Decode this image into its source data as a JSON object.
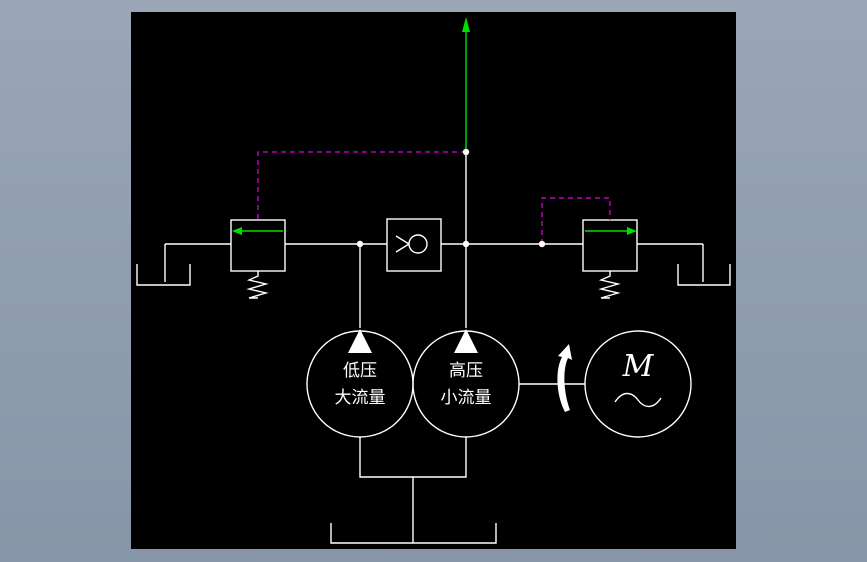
{
  "pump_low": {
    "line1": "低压",
    "line2": "大流量"
  },
  "pump_high": {
    "line1": "高压",
    "line2": "小流量"
  },
  "motor": {
    "letter": "M"
  },
  "colors": {
    "background": "#000000",
    "frame": "#8f9bad",
    "lines": "#ffffff",
    "arrows": "#00e000",
    "pilot_lines": "#c000c0"
  }
}
